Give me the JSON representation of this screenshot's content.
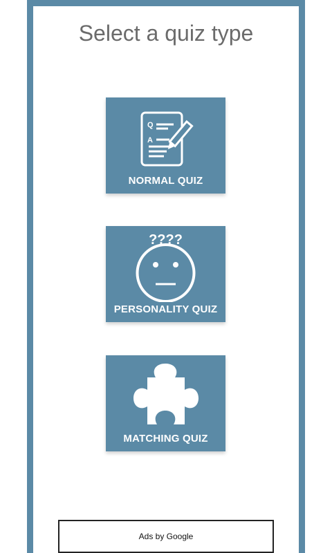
{
  "screen": {
    "title": "Select a quiz type",
    "accent_color": "#5b8aa6"
  },
  "quiz_types": [
    {
      "label": "NORMAL QUIZ",
      "icon": "document-pencil-icon"
    },
    {
      "label": "PERSONALITY QUIZ",
      "icon": "neutral-face-icon",
      "icon_text": "????"
    },
    {
      "label": "MATCHING QUIZ",
      "icon": "puzzle-piece-icon"
    }
  ],
  "ad": {
    "label": "Ads by Google"
  }
}
